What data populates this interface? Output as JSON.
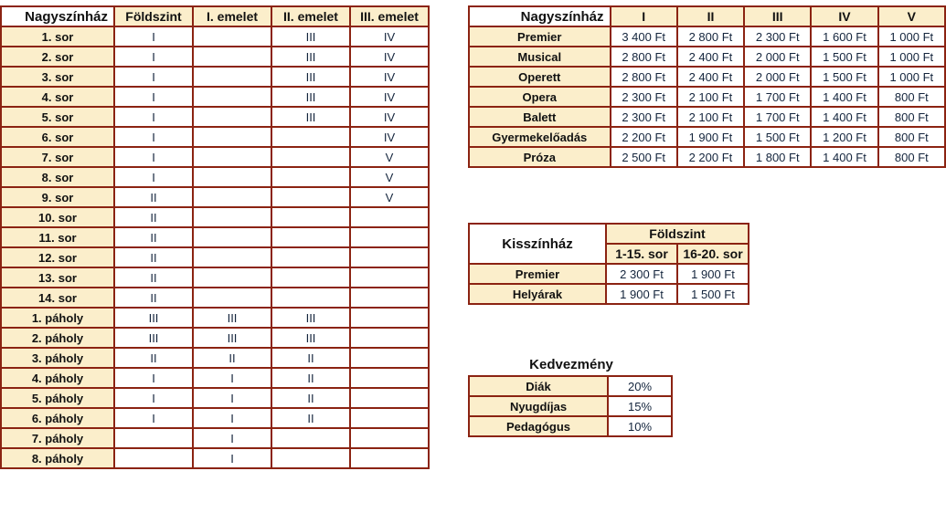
{
  "seat_table": {
    "corner_title": "Nagyszínház",
    "columns": [
      "Földszint",
      "I. emelet",
      "II. emelet",
      "III. emelet"
    ],
    "rows": [
      {
        "label": "1. sor",
        "values": [
          "I",
          "",
          "III",
          "IV"
        ]
      },
      {
        "label": "2. sor",
        "values": [
          "I",
          "",
          "III",
          "IV"
        ]
      },
      {
        "label": "3. sor",
        "values": [
          "I",
          "",
          "III",
          "IV"
        ]
      },
      {
        "label": "4. sor",
        "values": [
          "I",
          "",
          "III",
          "IV"
        ]
      },
      {
        "label": "5. sor",
        "values": [
          "I",
          "",
          "III",
          "IV"
        ]
      },
      {
        "label": "6. sor",
        "values": [
          "I",
          "",
          "",
          "IV"
        ]
      },
      {
        "label": "7. sor",
        "values": [
          "I",
          "",
          "",
          "V"
        ]
      },
      {
        "label": "8. sor",
        "values": [
          "I",
          "",
          "",
          "V"
        ]
      },
      {
        "label": "9. sor",
        "values": [
          "II",
          "",
          "",
          "V"
        ]
      },
      {
        "label": "10. sor",
        "values": [
          "II",
          "",
          "",
          ""
        ]
      },
      {
        "label": "11. sor",
        "values": [
          "II",
          "",
          "",
          ""
        ]
      },
      {
        "label": "12. sor",
        "values": [
          "II",
          "",
          "",
          ""
        ]
      },
      {
        "label": "13. sor",
        "values": [
          "II",
          "",
          "",
          ""
        ]
      },
      {
        "label": "14. sor",
        "values": [
          "II",
          "",
          "",
          ""
        ]
      },
      {
        "label": "1. páholy",
        "values": [
          "III",
          "III",
          "III",
          ""
        ]
      },
      {
        "label": "2. páholy",
        "values": [
          "III",
          "III",
          "III",
          ""
        ]
      },
      {
        "label": "3. páholy",
        "values": [
          "II",
          "II",
          "II",
          ""
        ]
      },
      {
        "label": "4. páholy",
        "values": [
          "I",
          "I",
          "II",
          ""
        ]
      },
      {
        "label": "5. páholy",
        "values": [
          "I",
          "I",
          "II",
          ""
        ]
      },
      {
        "label": "6. páholy",
        "values": [
          "I",
          "I",
          "II",
          ""
        ]
      },
      {
        "label": "7. páholy",
        "values": [
          "",
          "I",
          "",
          ""
        ]
      },
      {
        "label": "8. páholy",
        "values": [
          "",
          "I",
          "",
          ""
        ]
      }
    ]
  },
  "price_table": {
    "corner_title": "Nagyszínház",
    "columns": [
      "I",
      "II",
      "III",
      "IV",
      "V"
    ],
    "rows": [
      {
        "label": "Premier",
        "values": [
          "3 400 Ft",
          "2 800 Ft",
          "2 300 Ft",
          "1 600 Ft",
          "1 000 Ft"
        ]
      },
      {
        "label": "Musical",
        "values": [
          "2 800 Ft",
          "2 400 Ft",
          "2 000 Ft",
          "1 500 Ft",
          "1 000 Ft"
        ]
      },
      {
        "label": "Operett",
        "values": [
          "2 800 Ft",
          "2 400 Ft",
          "2 000 Ft",
          "1 500 Ft",
          "1 000 Ft"
        ]
      },
      {
        "label": "Opera",
        "values": [
          "2 300 Ft",
          "2 100 Ft",
          "1 700 Ft",
          "1 400 Ft",
          "800 Ft"
        ]
      },
      {
        "label": "Balett",
        "values": [
          "2 300 Ft",
          "2 100 Ft",
          "1 700 Ft",
          "1 400 Ft",
          "800 Ft"
        ]
      },
      {
        "label": "Gyermekelőadás",
        "values": [
          "2 200 Ft",
          "1 900 Ft",
          "1 500 Ft",
          "1 200 Ft",
          "800 Ft"
        ]
      },
      {
        "label": "Próza",
        "values": [
          "2 500 Ft",
          "2 200 Ft",
          "1 800 Ft",
          "1 400 Ft",
          "800 Ft"
        ]
      }
    ]
  },
  "small_table": {
    "corner_title": "Kisszínház",
    "group_header": "Földszint",
    "columns": [
      "1-15. sor",
      "16-20. sor"
    ],
    "rows": [
      {
        "label": "Premier",
        "values": [
          "2 300 Ft",
          "1 900 Ft"
        ]
      },
      {
        "label": "Helyárak",
        "values": [
          "1 900 Ft",
          "1 500 Ft"
        ]
      }
    ]
  },
  "discount_table": {
    "title": "Kedvezmény",
    "rows": [
      {
        "label": "Diák",
        "value": "20%"
      },
      {
        "label": "Nyugdíjas",
        "value": "15%"
      },
      {
        "label": "Pedagógus",
        "value": "10%"
      }
    ]
  },
  "colors": {
    "border": "#8B2312",
    "header_fill": "#FBEECB",
    "cell_fill": "#FFFFFF",
    "text": "#111111",
    "value_text": "#14253D"
  }
}
